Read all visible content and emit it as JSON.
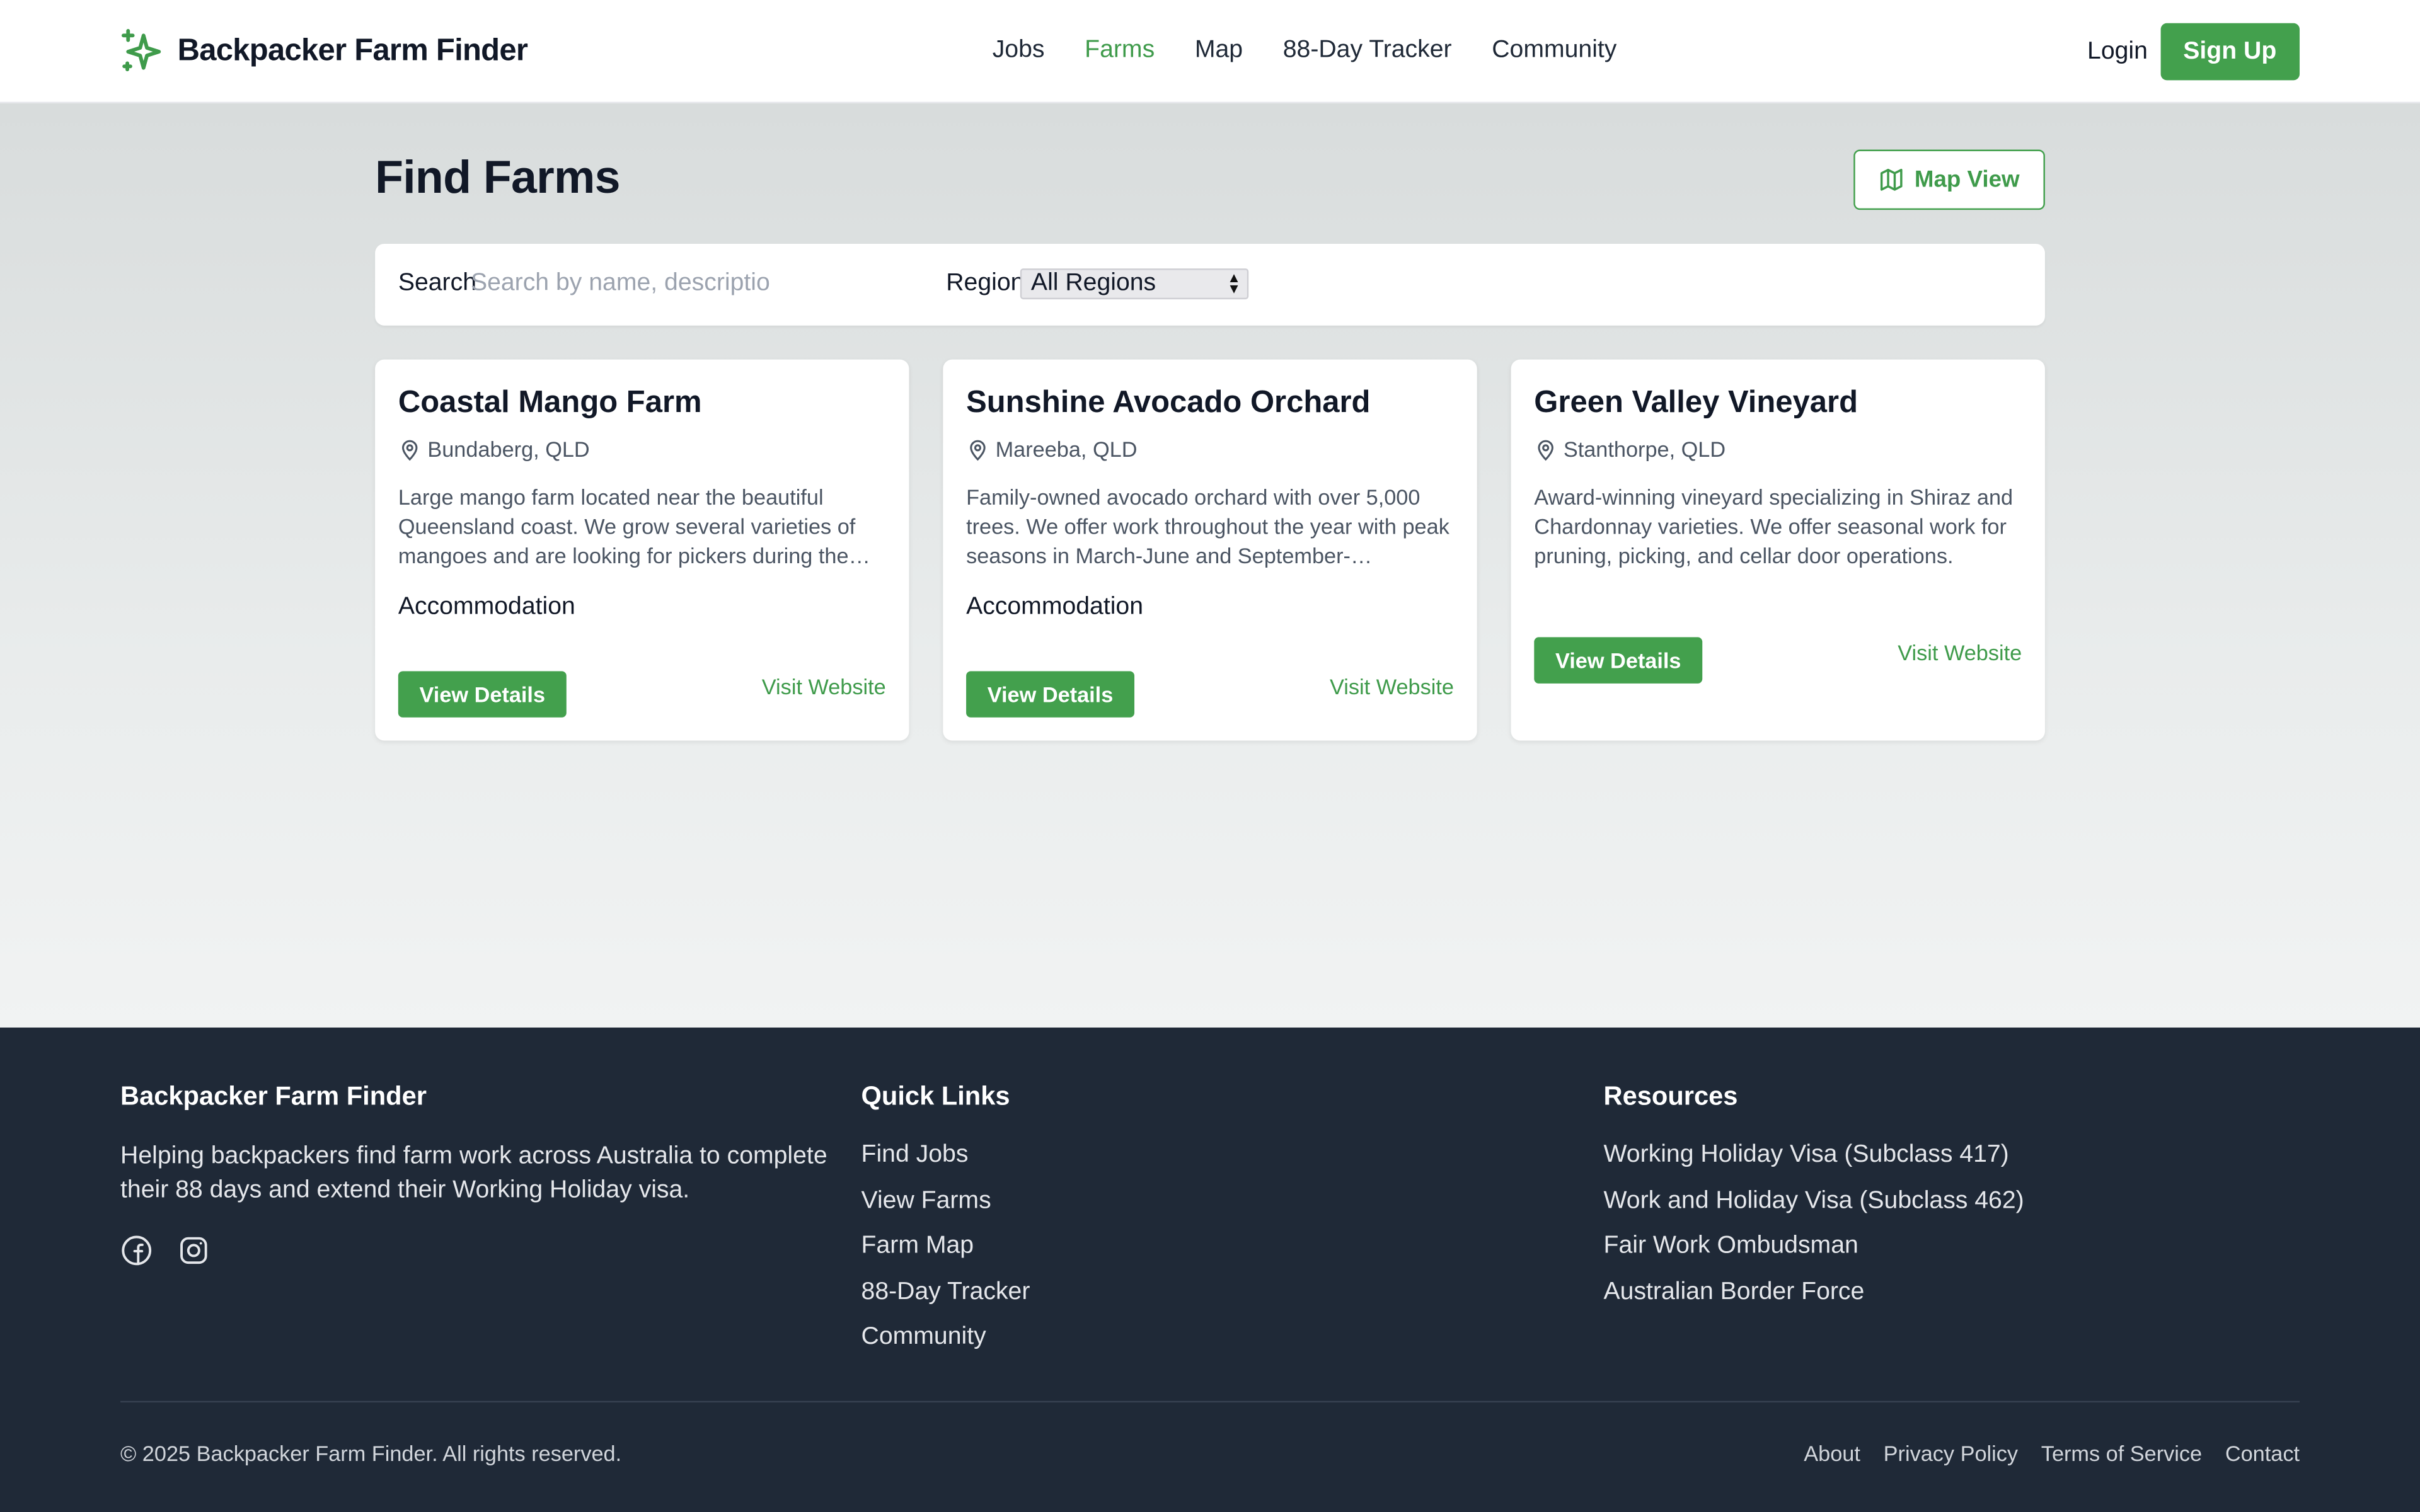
{
  "brand": {
    "name": "Backpacker Farm Finder",
    "icon": "sparkle-icon",
    "accent_color": "#43a04d"
  },
  "nav": [
    {
      "label": "Jobs",
      "active": false
    },
    {
      "label": "Farms",
      "active": true
    },
    {
      "label": "Map",
      "active": false
    },
    {
      "label": "88-Day Tracker",
      "active": false
    },
    {
      "label": "Community",
      "active": false
    }
  ],
  "auth": {
    "login_label": "Login",
    "signup_label": "Sign Up"
  },
  "page": {
    "title": "Find Farms",
    "map_view_label": "Map View",
    "map_view_icon": "map-icon"
  },
  "filters": {
    "search_label": "Search",
    "search_placeholder": "Search by name, descriptio",
    "search_value": "",
    "region_label": "Region",
    "region_selected": "All Regions"
  },
  "farms": [
    {
      "name": "Coastal Mango Farm",
      "location": "Bundaberg, QLD",
      "description": "Large mango farm located near the beautiful Queensland coast. We grow several varieties of mangoes and are looking for pickers during the harvest season.",
      "amenity": "Accommodation",
      "details_label": "View Details",
      "website_label": "Visit Website"
    },
    {
      "name": "Sunshine Avocado Orchard",
      "location": "Mareeba, QLD",
      "description": "Family-owned avocado orchard with over 5,000 trees. We offer work throughout the year with peak seasons in March-June and September-November.",
      "amenity": "Accommodation",
      "details_label": "View Details",
      "website_label": "Visit Website"
    },
    {
      "name": "Green Valley Vineyard",
      "location": "Stanthorpe, QLD",
      "description": "Award-winning vineyard specializing in Shiraz and Chardonnay varieties. We offer seasonal work for pruning, picking, and cellar door operations.",
      "amenity": "",
      "details_label": "View Details",
      "website_label": "Visit Website"
    }
  ],
  "footer": {
    "about": {
      "title": "Backpacker Farm Finder",
      "description": "Helping backpackers find farm work across Australia to complete their 88 days and extend their Working Holiday visa.",
      "social_icons": [
        "facebook-icon",
        "instagram-icon"
      ]
    },
    "quick_links": {
      "title": "Quick Links",
      "items": [
        "Find Jobs",
        "View Farms",
        "Farm Map",
        "88-Day Tracker",
        "Community"
      ]
    },
    "resources": {
      "title": "Resources",
      "items": [
        "Working Holiday Visa (Subclass 417)",
        "Work and Holiday Visa (Subclass 462)",
        "Fair Work Ombudsman",
        "Australian Border Force"
      ]
    },
    "copyright": "© 2025 Backpacker Farm Finder. All rights reserved.",
    "bottom_links": [
      "About",
      "Privacy Policy",
      "Terms of Service",
      "Contact"
    ]
  }
}
